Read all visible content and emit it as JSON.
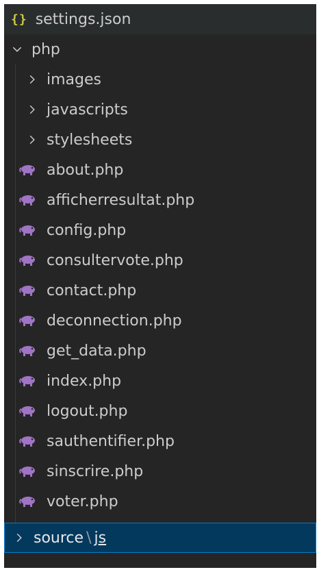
{
  "explorer": {
    "top_file": {
      "label": "settings.json",
      "icon": "json-braces-icon",
      "icon_glyph": "{}"
    },
    "folder": {
      "label": "php",
      "expanded": true
    },
    "subfolders": [
      {
        "label": "images",
        "expanded": false
      },
      {
        "label": "javascripts",
        "expanded": false
      },
      {
        "label": "stylesheets",
        "expanded": false
      }
    ],
    "files": [
      {
        "label": "about.php"
      },
      {
        "label": "afficherresultat.php"
      },
      {
        "label": "config.php"
      },
      {
        "label": "consultervote.php"
      },
      {
        "label": "contact.php"
      },
      {
        "label": "deconnection.php"
      },
      {
        "label": "get_data.php"
      },
      {
        "label": "index.php"
      },
      {
        "label": "logout.php"
      },
      {
        "label": "sauthentifier.php"
      },
      {
        "label": "sinscrire.php"
      },
      {
        "label": "voter.php"
      }
    ],
    "selected_folder": {
      "part1": "source",
      "separator": "\\",
      "part2": "js",
      "expanded": false
    },
    "colors": {
      "background": "#252526",
      "text": "#cccccc",
      "php_icon": "#a074c4",
      "json_icon": "#cbcb41",
      "selection_bg": "#04395e",
      "selection_border": "#007fd4"
    }
  }
}
